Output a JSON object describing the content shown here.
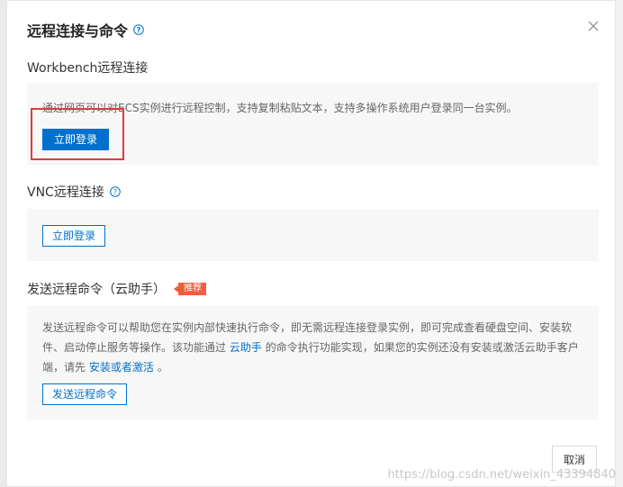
{
  "dialog": {
    "title": "远程连接与命令",
    "close_icon": "close-icon",
    "help_icon": "help-circle-icon"
  },
  "workbench": {
    "title": "Workbench远程连接",
    "description": "通过网页可以对ECS实例进行远程控制，支持复制粘贴文本，支持多操作系统用户登录同一台实例。",
    "button_label": "立即登录"
  },
  "vnc": {
    "title": "VNC远程连接",
    "button_label": "立即登录"
  },
  "cloud_assistant": {
    "title": "发送远程命令（云助手）",
    "badge": "推荐",
    "description_part1": "发送远程命令可以帮助您在实例内部快速执行命令，即无需远程连接登录实例，即可完成查看硬盘空间、安装软件、启动停止服务等操作。该功能通过",
    "link1": "云助手",
    "description_part2": "的命令执行功能实现，如果您的实例还没有安装或激活云助手客户端，请先",
    "link2": "安装或者激活",
    "description_part3": "。",
    "button_label": "发送远程命令"
  },
  "footer": {
    "cancel_label": "取消"
  },
  "watermark": "https://blog.csdn.net/weixin_43394840",
  "colors": {
    "primary": "#0070cc",
    "badge": "#f35c40",
    "highlight": "#e4393c"
  }
}
